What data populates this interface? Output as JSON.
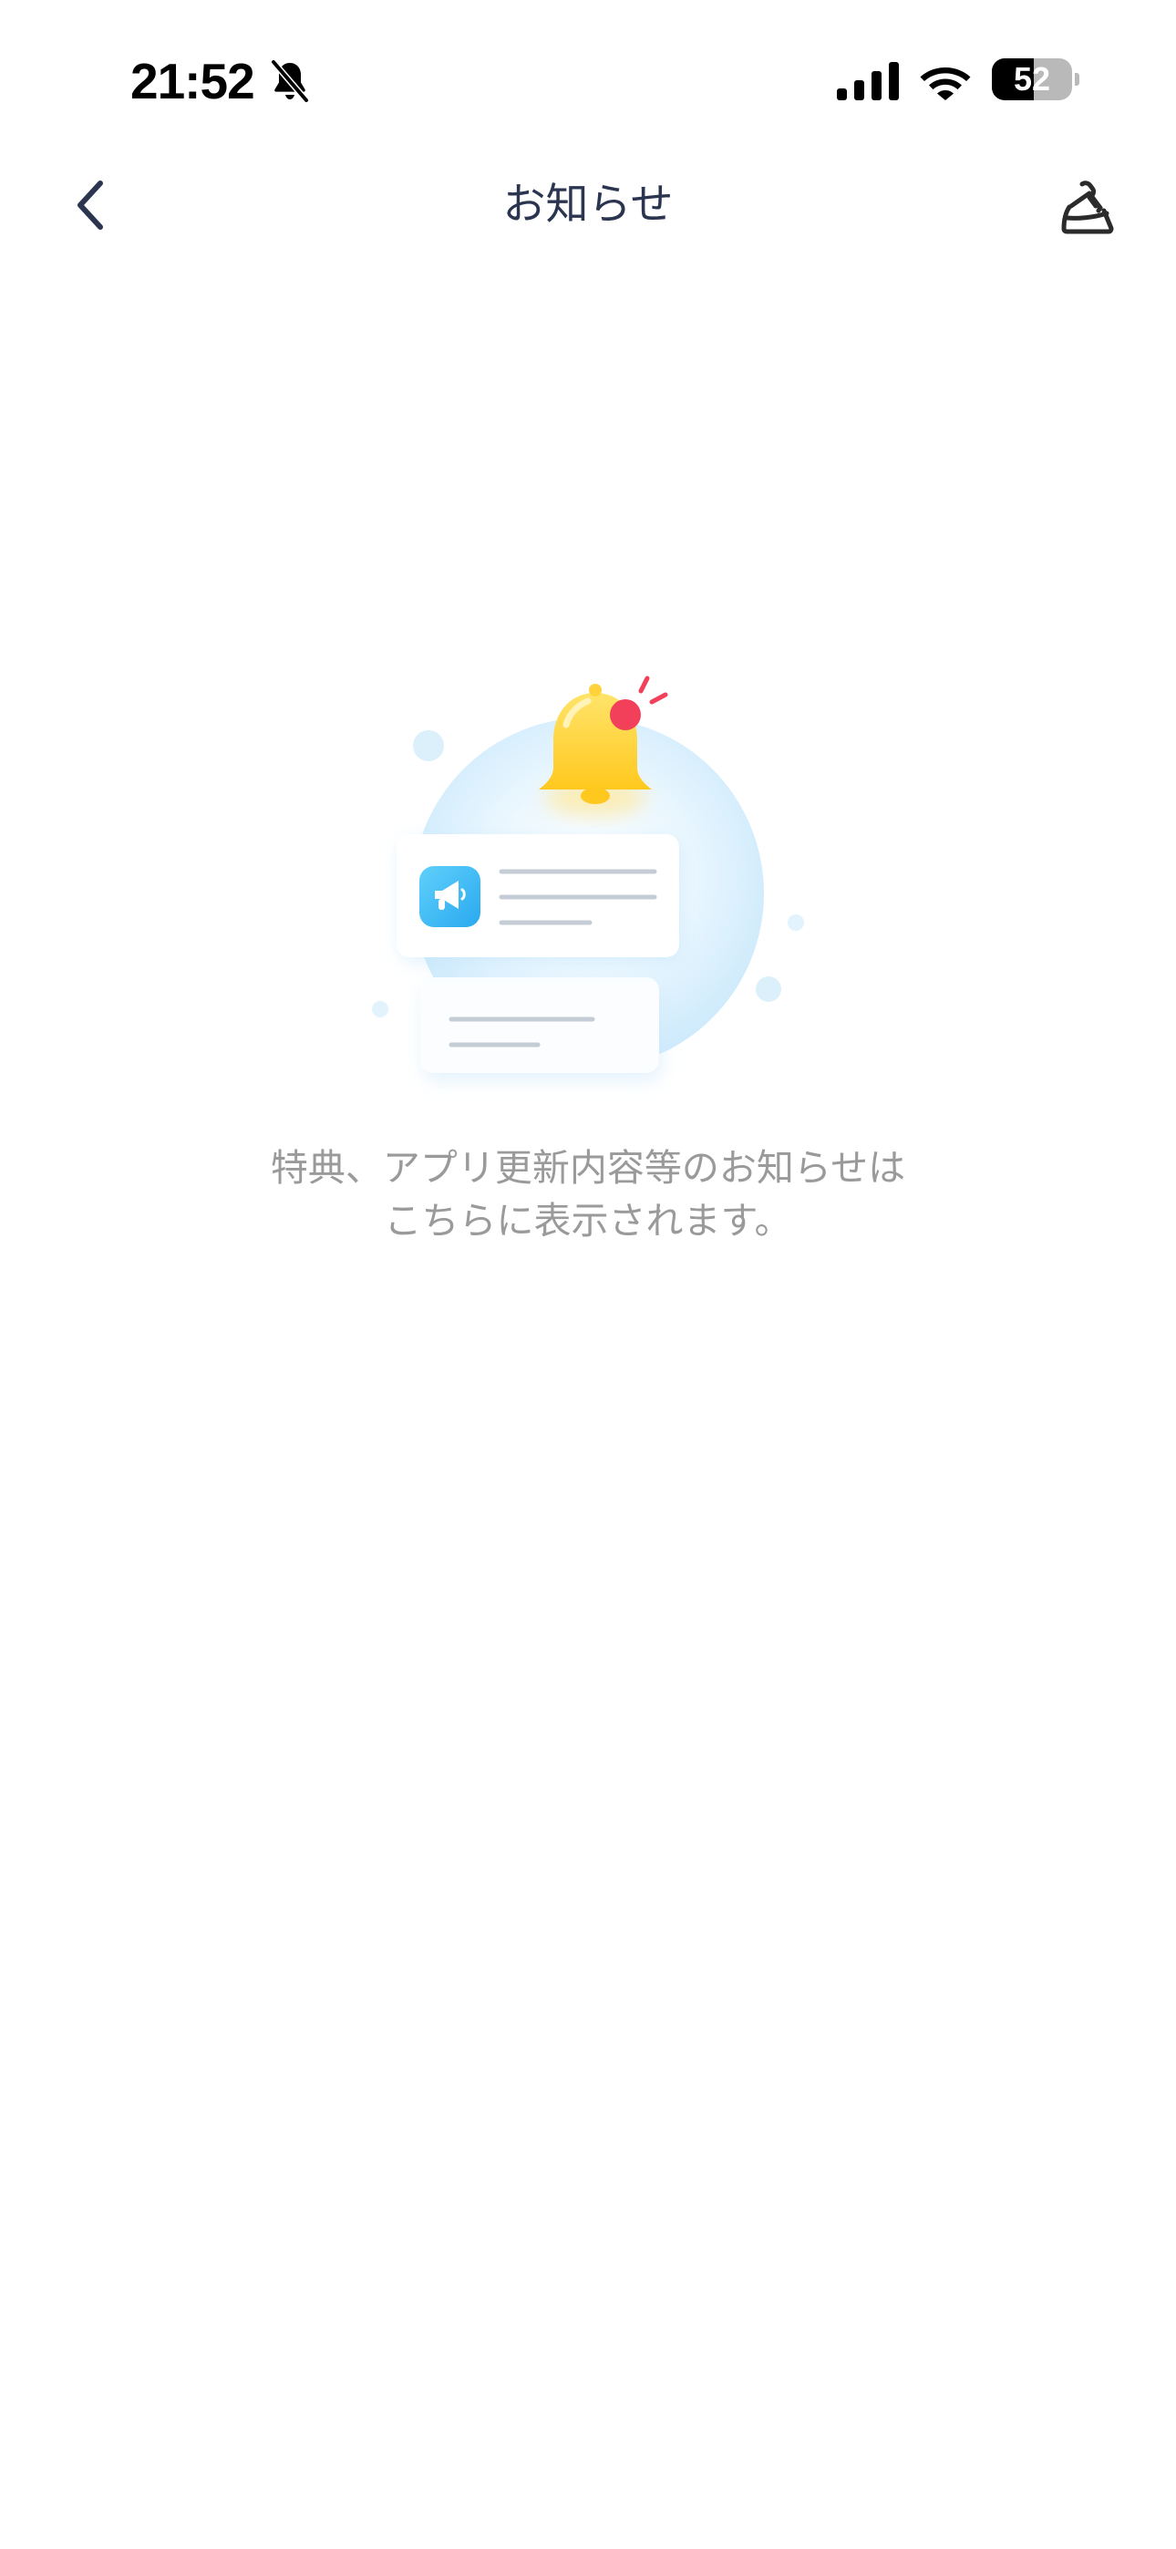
{
  "status_bar": {
    "time": "21:52",
    "battery_level": "52",
    "battery_fraction": 0.52,
    "icons": [
      "bell-slash-icon",
      "cellular-signal-icon",
      "wifi-icon",
      "battery-icon"
    ]
  },
  "nav": {
    "title": "お知らせ",
    "back_icon": "chevron-left-icon",
    "clean_icon": "broom-icon"
  },
  "empty_state": {
    "illustration": "bell-notification-illustration",
    "message_line1": "特典、アプリ更新内容等のお知らせは",
    "message_line2": "こちらに表示されます。"
  },
  "colors": {
    "title": "#2b3550",
    "message": "#9a9a9a",
    "bell": "#ffd23c",
    "badge": "#f2405a",
    "megaphone_tile": "#34b8f5",
    "circle": "#d9f0fd"
  }
}
